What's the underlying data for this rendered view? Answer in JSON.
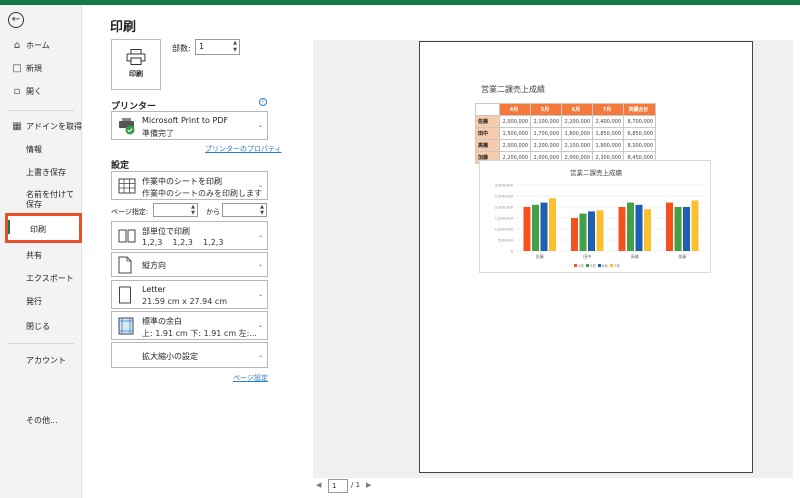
{
  "sidebar": {
    "back_icon": "back-arrow-icon",
    "items": [
      {
        "label": "ホーム",
        "icon": "home-icon"
      },
      {
        "label": "新規",
        "icon": "new-document-icon"
      },
      {
        "label": "開く",
        "icon": "open-folder-icon"
      },
      {
        "label": "アドインを取得",
        "icon": "addins-grid-icon"
      },
      {
        "label": "情報"
      },
      {
        "label": "上書き保存"
      },
      {
        "label": "名前を付けて保存"
      },
      {
        "label": "印刷"
      },
      {
        "label": "共有"
      },
      {
        "label": "エクスポート"
      },
      {
        "label": "発行"
      },
      {
        "label": "閉じる"
      },
      {
        "label": "アカウント"
      },
      {
        "label": "その他..."
      }
    ]
  },
  "page_title": "印刷",
  "print_button_label": "印刷",
  "copies": {
    "label": "部数:",
    "value": "1"
  },
  "printer": {
    "section_label": "プリンター",
    "name": "Microsoft Print to PDF",
    "status": "準備完了",
    "properties_link": "プリンターのプロパティ"
  },
  "settings": {
    "section_label": "設定",
    "scope": {
      "title": "作業中のシートを印刷",
      "subtitle": "作業中のシートのみを印刷します"
    },
    "pages": {
      "label": "ページ指定:",
      "to": "から",
      "from_value": "",
      "to_value": ""
    },
    "collate": {
      "title": "部単位で印刷",
      "subtitle": "1,2,3    1,2,3    1,2,3"
    },
    "orientation": {
      "title": "縦方向"
    },
    "paper": {
      "title": "Letter",
      "subtitle": "21.59 cm x 27.94 cm"
    },
    "margins": {
      "title": "標準の余白",
      "subtitle": "上: 1.91 cm 下: 1.91 cm 左:..."
    },
    "scaling": {
      "title": "拡大縮小の設定"
    },
    "page_setup_link": "ページ設定"
  },
  "preview": {
    "sheet_title": "営業二課売上成績",
    "table": {
      "headers": [
        "",
        "4月",
        "5月",
        "6月",
        "7月",
        "実績合計"
      ],
      "rows": [
        [
          "佐藤",
          "2,000,000",
          "2,100,000",
          "2,200,000",
          "2,400,000",
          "8,700,000"
        ],
        [
          "田中",
          "1,500,000",
          "1,700,000",
          "1,800,000",
          "1,850,000",
          "6,850,000"
        ],
        [
          "高橋",
          "2,000,000",
          "2,200,000",
          "2,100,000",
          "1,900,000",
          "8,200,000"
        ],
        [
          "加藤",
          "2,200,000",
          "2,000,000",
          "2,000,000",
          "2,300,000",
          "8,450,000"
        ]
      ]
    },
    "chart_data": {
      "type": "bar",
      "title": "営業二課売上成績",
      "categories": [
        "佐藤",
        "田中",
        "高橋",
        "加藤"
      ],
      "series": [
        {
          "name": "4月",
          "values": [
            2000000,
            1500000,
            2000000,
            2200000
          ],
          "color": "#f4511e"
        },
        {
          "name": "5月",
          "values": [
            2100000,
            1700000,
            2200000,
            2000000
          ],
          "color": "#43a047"
        },
        {
          "name": "6月",
          "values": [
            2200000,
            1800000,
            2100000,
            2000000
          ],
          "color": "#1e5fb0"
        },
        {
          "name": "7月",
          "values": [
            2400000,
            1850000,
            1900000,
            2300000
          ],
          "color": "#fbc02d"
        }
      ],
      "y_ticks": [
        "0",
        "500,000",
        "1,000,000",
        "1,500,000",
        "2,000,000",
        "2,500,000",
        "3,000,000"
      ],
      "ylim": [
        0,
        3000000
      ],
      "grid": true,
      "legend": "bottom"
    },
    "pager": {
      "current": "1",
      "total": "/ 1"
    }
  }
}
